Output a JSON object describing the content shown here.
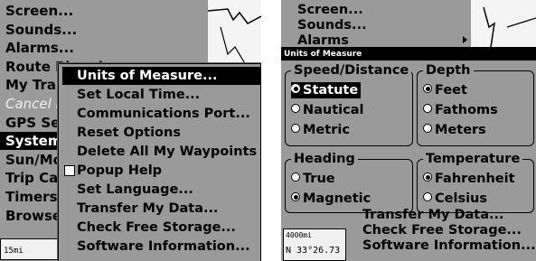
{
  "left": {
    "menu_items": [
      {
        "label": "Screen...",
        "state": "normal"
      },
      {
        "label": "Sounds...",
        "state": "normal"
      },
      {
        "label": "Alarms...",
        "state": "normal"
      },
      {
        "label": "Route Planning...",
        "state": "normal"
      },
      {
        "label": "My Trails...",
        "state": "normal"
      },
      {
        "label": "Cancel Navigation",
        "state": "dim"
      },
      {
        "label": "GPS Setup...",
        "state": "normal"
      },
      {
        "label": "System Setup...",
        "state": "selected"
      },
      {
        "label": "Sun/Moon Calculations...",
        "state": "normal"
      },
      {
        "label": "Trip Calculator...",
        "state": "normal"
      },
      {
        "label": "Timers...",
        "state": "normal"
      },
      {
        "label": "Browse Files...",
        "state": "normal"
      }
    ],
    "submenu_items": [
      {
        "label": "Units of Measure...",
        "selected": true,
        "checkbox": false
      },
      {
        "label": "Set Local Time...",
        "selected": false,
        "checkbox": false
      },
      {
        "label": "Communications Port...",
        "selected": false,
        "checkbox": false
      },
      {
        "label": "Reset Options",
        "selected": false,
        "checkbox": false
      },
      {
        "label": "Delete All My Waypoints",
        "selected": false,
        "checkbox": false
      },
      {
        "label": "Popup Help",
        "selected": false,
        "checkbox": true
      },
      {
        "label": "Set Language...",
        "selected": false,
        "checkbox": false
      },
      {
        "label": "Transfer My Data...",
        "selected": false,
        "checkbox": false
      },
      {
        "label": "Check Free Storage...",
        "selected": false,
        "checkbox": false
      },
      {
        "label": "Software Information...",
        "selected": false,
        "checkbox": false
      }
    ],
    "status_text": "15mi"
  },
  "right": {
    "menu_items": [
      "Screen...",
      "Sounds...",
      "Alarms"
    ],
    "dialog_title": "Units of Measure",
    "groups": [
      {
        "label": "Speed/Distance",
        "options": [
          {
            "label": "Statute",
            "checked": true,
            "selected": true
          },
          {
            "label": "Nautical",
            "checked": false,
            "selected": false
          },
          {
            "label": "Metric",
            "checked": false,
            "selected": false
          }
        ]
      },
      {
        "label": "Depth",
        "options": [
          {
            "label": "Feet",
            "checked": true,
            "selected": false
          },
          {
            "label": "Fathoms",
            "checked": false,
            "selected": false
          },
          {
            "label": "Meters",
            "checked": false,
            "selected": false
          }
        ]
      },
      {
        "label": "Heading",
        "options": [
          {
            "label": "True",
            "checked": false,
            "selected": false
          },
          {
            "label": "Magnetic",
            "checked": true,
            "selected": false
          }
        ]
      },
      {
        "label": "Temperature",
        "options": [
          {
            "label": "Fahrenheit",
            "checked": true,
            "selected": false
          },
          {
            "label": "Celsius",
            "checked": false,
            "selected": false
          }
        ]
      }
    ],
    "bottom_items": [
      "Transfer My Data...",
      "Check Free Storage...",
      "Software Information..."
    ],
    "status_scale": "4000mi",
    "status_coord": "N  33°26.73"
  }
}
